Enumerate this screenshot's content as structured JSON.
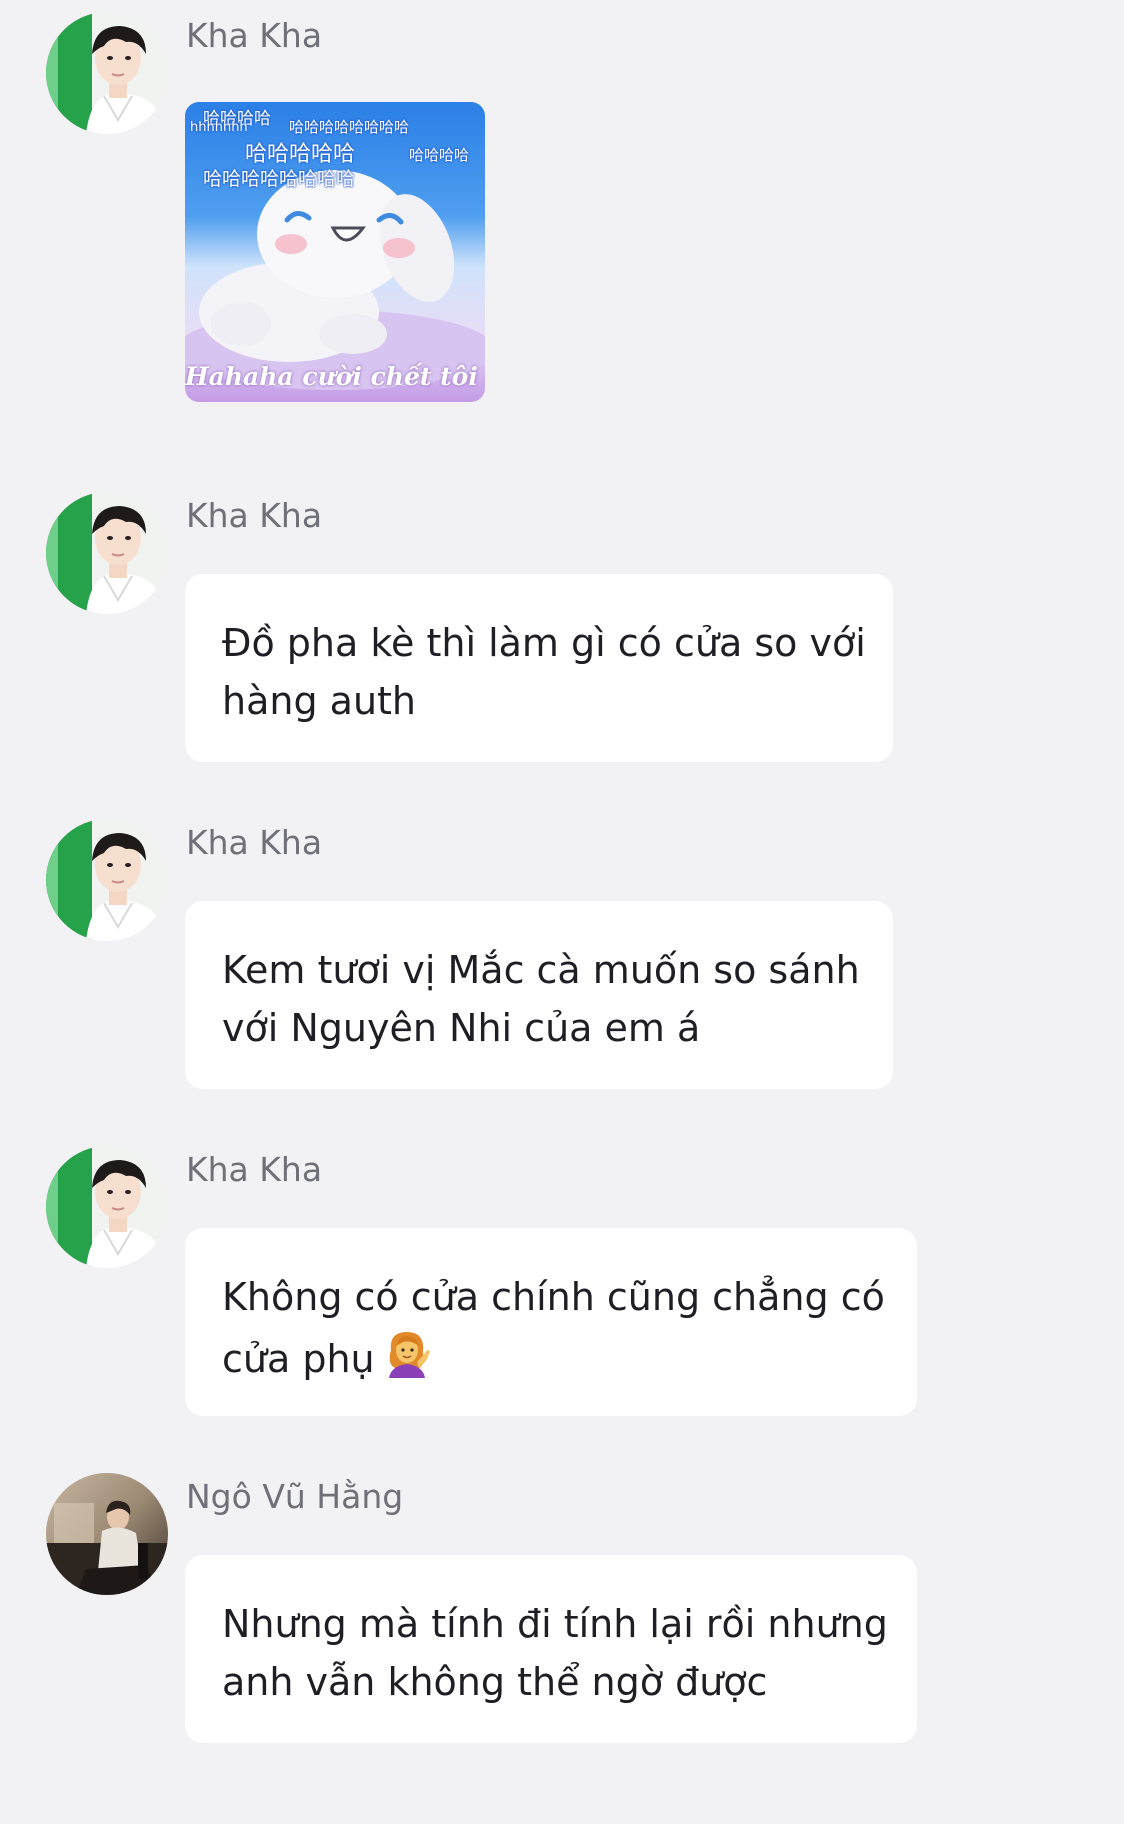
{
  "messages": [
    {
      "sender": "Kha Kha",
      "type": "sticker",
      "sticker": {
        "rows": [
          "哈哈哈哈",
          "hhhhhhh",
          "哈哈哈哈哈哈哈哈",
          "哈哈哈哈哈",
          "哈哈哈哈",
          "哈哈哈哈哈哈哈哈"
        ],
        "caption": "Hahaha cười chết tôi rồi"
      }
    },
    {
      "sender": "Kha Kha",
      "type": "text",
      "lines": [
        "Đồ pha kè thì làm gì có cửa so với",
        "hàng auth"
      ]
    },
    {
      "sender": "Kha Kha",
      "type": "text",
      "lines": [
        "Kem tươi vị Mắc cà muốn so sánh",
        "với Nguyên Nhi của em á"
      ]
    },
    {
      "sender": "Kha Kha",
      "type": "text",
      "lines": [
        "Không có cửa chính cũng chẳng có",
        "cửa phụ"
      ],
      "emoji": "woman-tipping-hand-emoji"
    },
    {
      "sender": "Ngô Vũ Hằng",
      "type": "text",
      "lines": [
        "Nhưng mà tính đi tính lại rồi nhưng",
        "anh vẫn không thể ngờ được"
      ]
    }
  ],
  "colors": {
    "background": "#f2f2f4",
    "bubble": "#ffffff",
    "sender_name": "#707078",
    "message_text": "#1e1e24",
    "sticker_blue": "#2f86e8",
    "sticker_lavender": "#c9a8e8"
  }
}
